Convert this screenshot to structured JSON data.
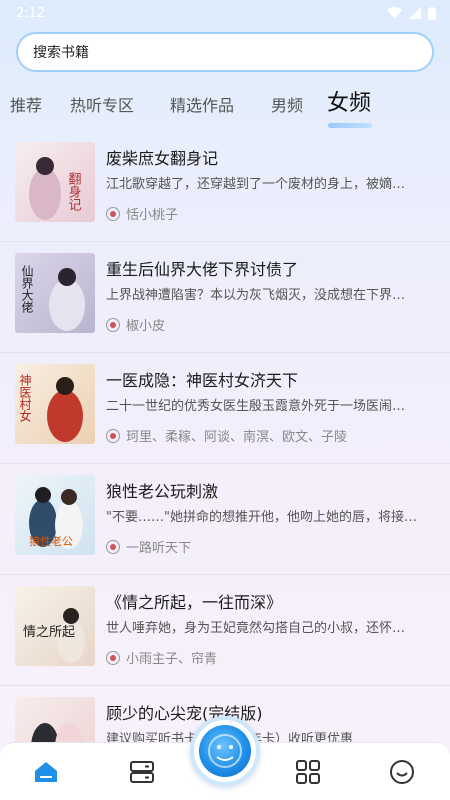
{
  "status": {
    "time": "2:12"
  },
  "search": {
    "placeholder": "搜索书籍"
  },
  "tabs": [
    {
      "label": "推荐"
    },
    {
      "label": "热听专区"
    },
    {
      "label": "精选作品"
    },
    {
      "label": "男频"
    },
    {
      "label": "女频",
      "active": true
    }
  ],
  "books": [
    {
      "title": "废柴庶女翻身记",
      "desc": "江北歌穿越了，还穿越到了一个废材的身上，被嫡…",
      "author": "恬小桃子",
      "cover_title": "翻身记",
      "cover_color": "#f1e2e6"
    },
    {
      "title": "重生后仙界大佬下界讨债了",
      "desc": "上界战神遭陷害？本以为灰飞烟灭，没成想在下界…",
      "author": "椒小皮",
      "cover_title": "仙界大佬",
      "cover_color": "#cfc8e0"
    },
    {
      "title": "一医成隐：神医村女济天下",
      "desc": "二十一世纪的优秀女医生殷玉霞意外死于一场医闹…",
      "author": "珂里、柔稼、阿谈、南溟、欧文、子陵",
      "cover_title": "神医村女",
      "cover_color": "#f4e6d6"
    },
    {
      "title": "狼性老公玩刺激",
      "desc": "\"不要……\"她拼命的想推开他，他吻上她的唇，将接…",
      "author": "一路听天下",
      "cover_title": "狼性老公",
      "cover_color": "#e3eef5"
    },
    {
      "title": "《情之所起，一往而深》",
      "desc": "世人唾弃她，身为王妃竟然勾搭自己的小叔，还怀…",
      "author": "小雨主子、帘青",
      "cover_title": "情之所起",
      "cover_color": "#f2ece2"
    },
    {
      "title": "顾少的心尖宠(完结版)",
      "desc": "建议购买听书卡（季卡、年卡）收听更优惠",
      "author": "",
      "cover_title": "",
      "cover_color": "#f2e4e4"
    }
  ],
  "nav": [
    {
      "icon": "home-icon"
    },
    {
      "icon": "bookshelf-icon"
    },
    {
      "icon": "player-icon"
    },
    {
      "icon": "category-icon"
    },
    {
      "icon": "profile-icon"
    }
  ],
  "colors": {
    "accent": "#1f8fe8",
    "search_border": "#9fd0fb"
  }
}
